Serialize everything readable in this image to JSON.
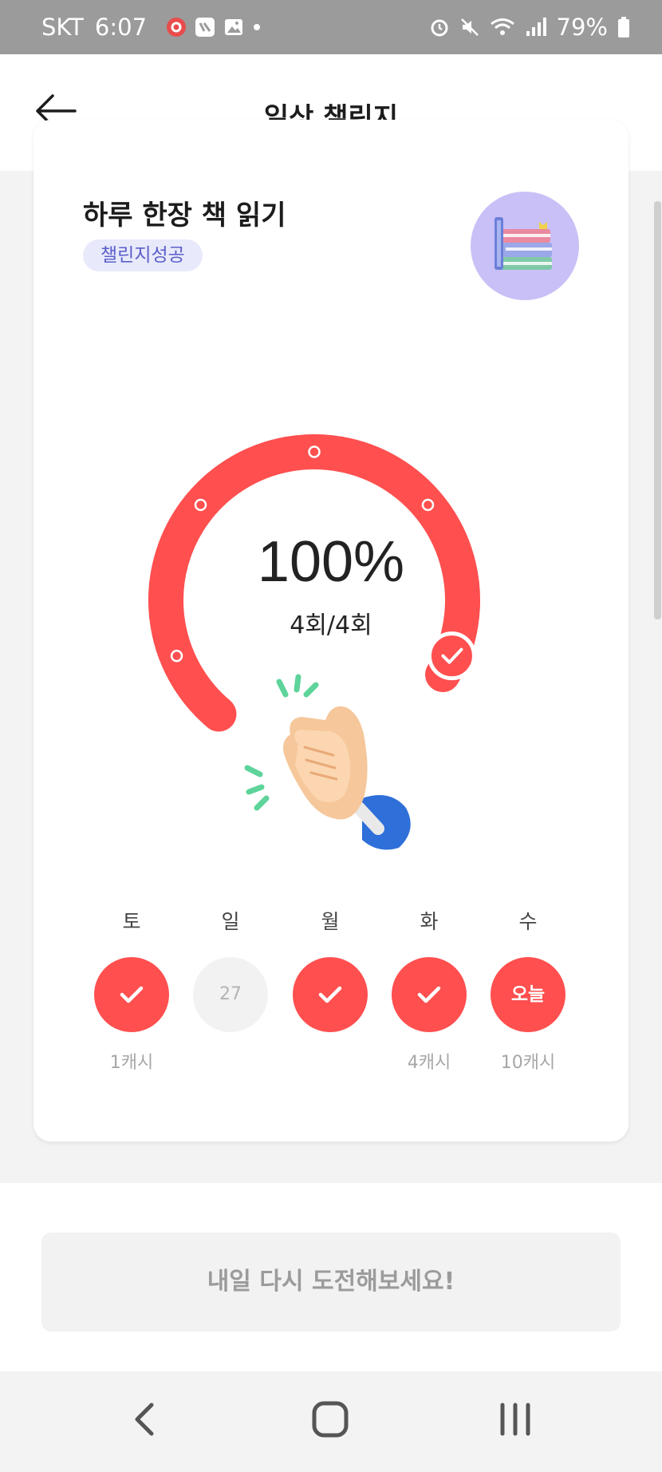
{
  "status_bar": {
    "carrier": "SKT",
    "time": "6:07",
    "battery": "79%"
  },
  "header": {
    "title": "일상 챌린지"
  },
  "challenge": {
    "title": "하루 한장 책 읽기",
    "badge": "챌린지성공",
    "progress_percent": "100%",
    "progress_value": 1.0,
    "count": "4회/4회"
  },
  "week": [
    {
      "day": "토",
      "state": "done",
      "reward": "1캐시"
    },
    {
      "day": "일",
      "state": "empty",
      "date": "27",
      "reward": ""
    },
    {
      "day": "월",
      "state": "done",
      "reward": ""
    },
    {
      "day": "화",
      "state": "done",
      "reward": "4캐시"
    },
    {
      "day": "수",
      "state": "today",
      "today_label": "오늘",
      "reward": "10캐시"
    }
  ],
  "action": {
    "retry_label": "내일 다시 도전해보세요!"
  },
  "colors": {
    "accent": "#ff4f4f",
    "badge_bg": "#e8e9fb",
    "badge_text": "#5b5fc9"
  },
  "icons": {
    "back": "arrow-left-icon",
    "book": "books-icon",
    "clap": "clapping-hands-icon",
    "check": "check-icon"
  }
}
